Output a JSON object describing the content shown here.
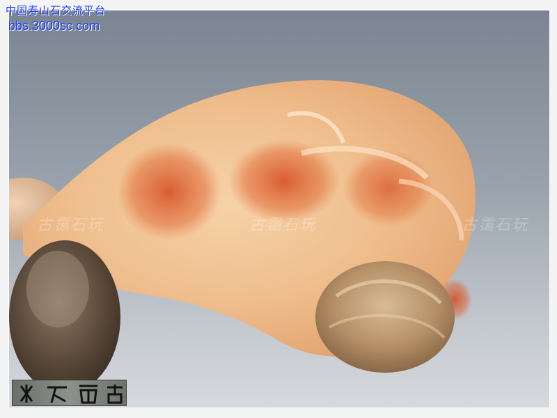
{
  "header": {
    "forum_name": "中国寿山石交流平台",
    "forum_url": "bbs.3000sc.com"
  },
  "watermarks": [
    {
      "text": "古霭石玩"
    },
    {
      "text": "古霭石玩"
    },
    {
      "text": "古霭石玩"
    }
  ],
  "seal": {
    "text": "玩石霭古"
  },
  "colors": {
    "header_text": "#1a3cff",
    "stone_body": "#f2c79a",
    "stone_speckle": "#d9481f",
    "background_top": "#7a8591",
    "background_bottom": "#d6d9dd"
  }
}
